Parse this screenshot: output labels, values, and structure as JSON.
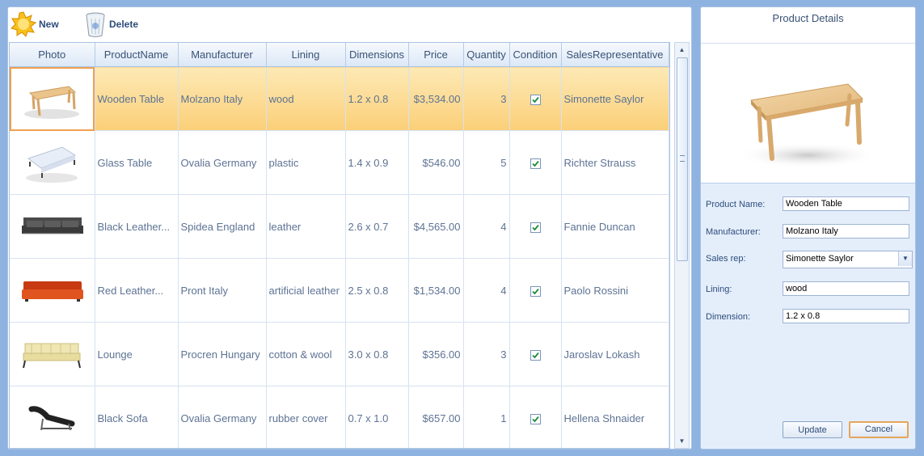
{
  "toolbar": {
    "new_label": "New",
    "delete_label": "Delete"
  },
  "grid": {
    "columns": [
      "Photo",
      "ProductName",
      "Manufacturer",
      "Lining",
      "Dimensions",
      "Price",
      "Quantity",
      "Condition",
      "SalesRepresentative"
    ],
    "rows": [
      {
        "photo": "wooden-table",
        "name": "Wooden Table",
        "manufacturer": "Molzano Italy",
        "lining": "wood",
        "dimensions": "1.2 x 0.8",
        "price": "$3,534.00",
        "quantity": "3",
        "condition": true,
        "rep": "Simonette Saylor",
        "selected": true
      },
      {
        "photo": "glass-table",
        "name": "Glass Table",
        "manufacturer": "Ovalia Germany",
        "lining": "plastic",
        "dimensions": "1.4 x 0.9",
        "price": "$546.00",
        "quantity": "5",
        "condition": true,
        "rep": "Richter Strauss",
        "selected": false
      },
      {
        "photo": "black-sofa",
        "name": "Black Leather...",
        "manufacturer": "Spidea England",
        "lining": "leather",
        "dimensions": "2.6 x 0.7",
        "price": "$4,565.00",
        "quantity": "4",
        "condition": true,
        "rep": "Fannie Duncan",
        "selected": false
      },
      {
        "photo": "red-sofa",
        "name": "Red Leather...",
        "manufacturer": "Pront Italy",
        "lining": "artificial leather",
        "dimensions": "2.5 x 0.8",
        "price": "$1,534.00",
        "quantity": "4",
        "condition": true,
        "rep": "Paolo Rossini",
        "selected": false
      },
      {
        "photo": "lounge",
        "name": "Lounge",
        "manufacturer": "Procren Hungary",
        "lining": "cotton & wool",
        "dimensions": "3.0 x 0.8",
        "price": "$356.00",
        "quantity": "3",
        "condition": true,
        "rep": "Jaroslav Lokash",
        "selected": false
      },
      {
        "photo": "black-lounger",
        "name": "Black Sofa",
        "manufacturer": "Ovalia Germany",
        "lining": "rubber cover",
        "dimensions": "0.7 x 1.0",
        "price": "$657.00",
        "quantity": "1",
        "condition": true,
        "rep": "Hellena Shnaider",
        "selected": false
      }
    ]
  },
  "details": {
    "title": "Product Details",
    "product_name_label": "Product Name:",
    "product_name": "Wooden Table",
    "manufacturer_label": "Manufacturer:",
    "manufacturer": "Molzano Italy",
    "sales_rep_label": "Sales rep:",
    "sales_rep": "Simonette Saylor",
    "lining_label": "Lining:",
    "lining": "wood",
    "dimension_label": "Dimension:",
    "dimension": "1.2 x 0.8",
    "update_label": "Update",
    "cancel_label": "Cancel"
  },
  "colors": {
    "selected_row": "#fbd386",
    "accent_border": "#f0a050",
    "check": "#1f8a3a"
  }
}
